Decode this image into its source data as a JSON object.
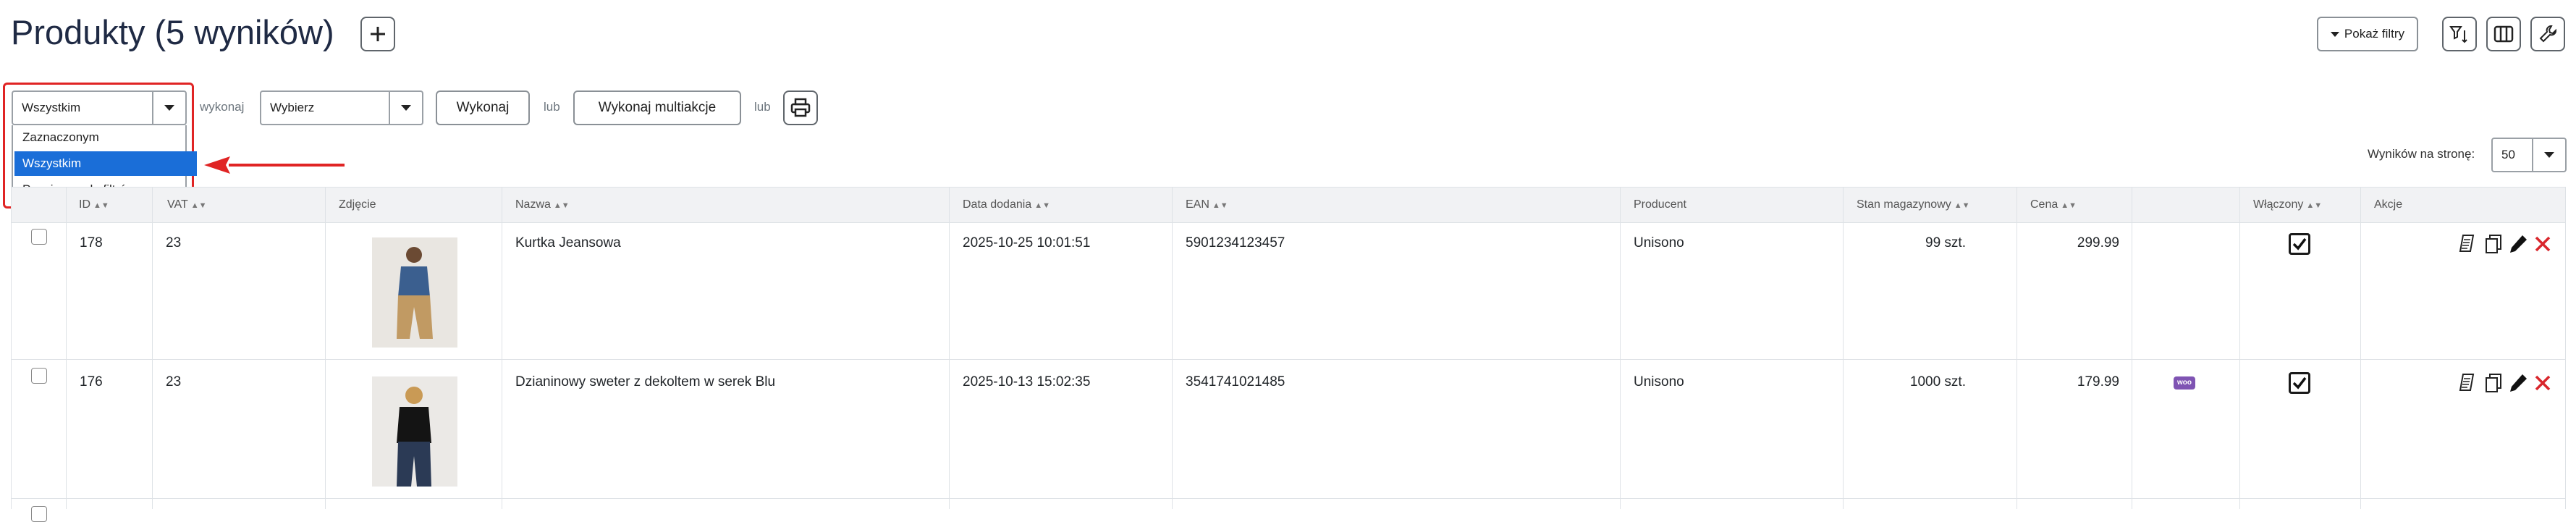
{
  "header": {
    "title": "Produkty (5 wyników)",
    "add_icon": "plus-icon",
    "show_filters": "Pokaż filtry",
    "toolbar_icons": [
      "filter-sort-icon",
      "columns-icon",
      "wrench-icon"
    ]
  },
  "actions_bar": {
    "scope_select_value": "Wszystkim",
    "label_execute": "wykonaj",
    "action_select_value": "Wybierz",
    "execute_button": "Wykonaj",
    "or_label_1": "lub",
    "multiaction_button": "Wykonaj multiakcje",
    "or_label_2": "lub",
    "print_icon": "printer-icon"
  },
  "scope_dropdown": {
    "options": [
      "Zaznaczonym",
      "Wszystkim",
      "Pasującym do filtrów"
    ],
    "selected_index": 1
  },
  "annotation": {
    "highlight_color": "#e02424",
    "arrow_color": "#e02424"
  },
  "per_page": {
    "label": "Wyników na stronę:",
    "value": "50"
  },
  "table": {
    "columns": [
      "",
      "ID",
      "VAT",
      "Zdjęcie",
      "Nazwa",
      "Data dodania",
      "EAN",
      "Producent",
      "Stan magazynowy",
      "Cena",
      "",
      "Włączony",
      "Akcje"
    ],
    "rows": [
      {
        "id": "178",
        "vat": "23",
        "name": "Kurtka Jeansowa",
        "date": "2025-10-25 10:01:51",
        "ean": "5901234123457",
        "producer": "Unisono",
        "stock": "99 szt.",
        "price": "299.99",
        "woo": "",
        "enabled": true
      },
      {
        "id": "176",
        "vat": "23",
        "name": "Dzianinowy sweter z dekoltem w serek Blu",
        "date": "2025-10-13 15:02:35",
        "ean": "3541741021485",
        "producer": "Unisono",
        "stock": "1000 szt.",
        "price": "179.99",
        "woo": "woo",
        "enabled": true
      }
    ],
    "action_icons": [
      "copy-sheet-icon",
      "duplicate-icon",
      "edit-pencil-icon",
      "delete-x-icon"
    ]
  },
  "colors": {
    "accent": "#1a6ed8",
    "delete": "#d9262c",
    "woo": "#7f54b3",
    "title": "#1f2a44"
  }
}
